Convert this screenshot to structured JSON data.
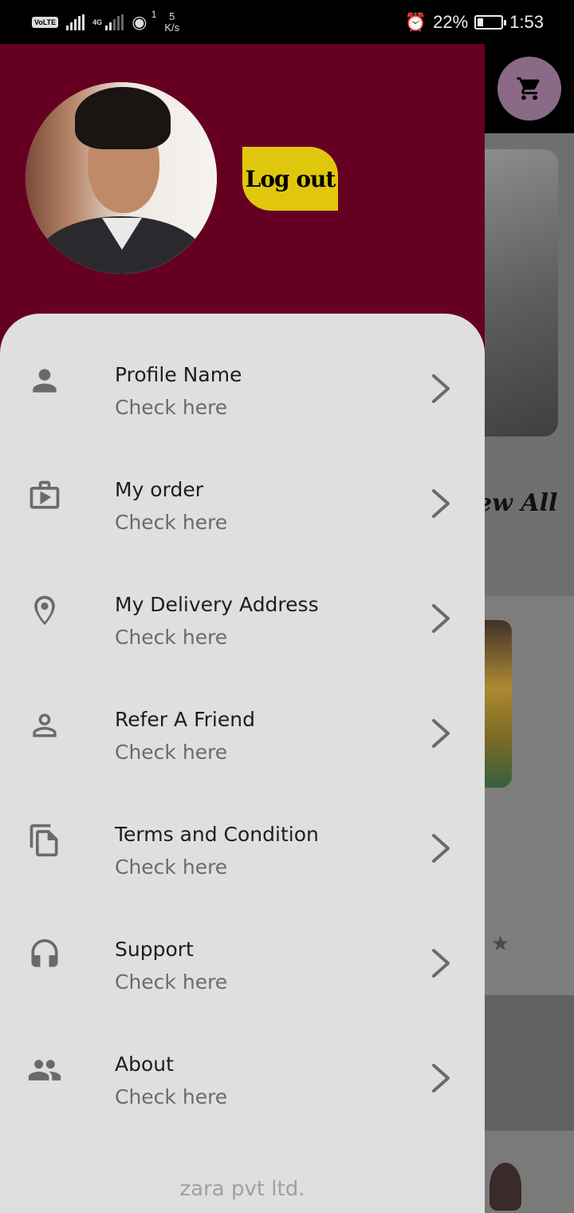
{
  "status_bar": {
    "net_label": "VoLTE",
    "net_type": "4G",
    "hotspot_users": "1",
    "speed_value": "5",
    "speed_unit": "K/s",
    "battery": "22%",
    "battery_level": 0.22,
    "time": "1:53"
  },
  "drawer": {
    "logout_label": "Log out",
    "menu": [
      {
        "title": "Profile Name",
        "subtitle": "Check here",
        "icon": "person-icon"
      },
      {
        "title": "My order",
        "subtitle": "Check here",
        "icon": "shopping-bag-icon"
      },
      {
        "title": "My Delivery Address",
        "subtitle": "Check here",
        "icon": "location-pin-icon"
      },
      {
        "title": "Refer A Friend",
        "subtitle": "Check here",
        "icon": "person-outline-icon"
      },
      {
        "title": "Terms and Condition",
        "subtitle": "Check here",
        "icon": "documents-icon"
      },
      {
        "title": "Support",
        "subtitle": "Check here",
        "icon": "headset-icon"
      },
      {
        "title": "About",
        "subtitle": "Check here",
        "icon": "group-icon"
      }
    ],
    "footer": "zara pvt ltd."
  },
  "background": {
    "view_all_label": "ew All"
  },
  "colors": {
    "header": "#660022",
    "logout": "#e0c70e",
    "drawer_bg": "#e0dfe0"
  }
}
